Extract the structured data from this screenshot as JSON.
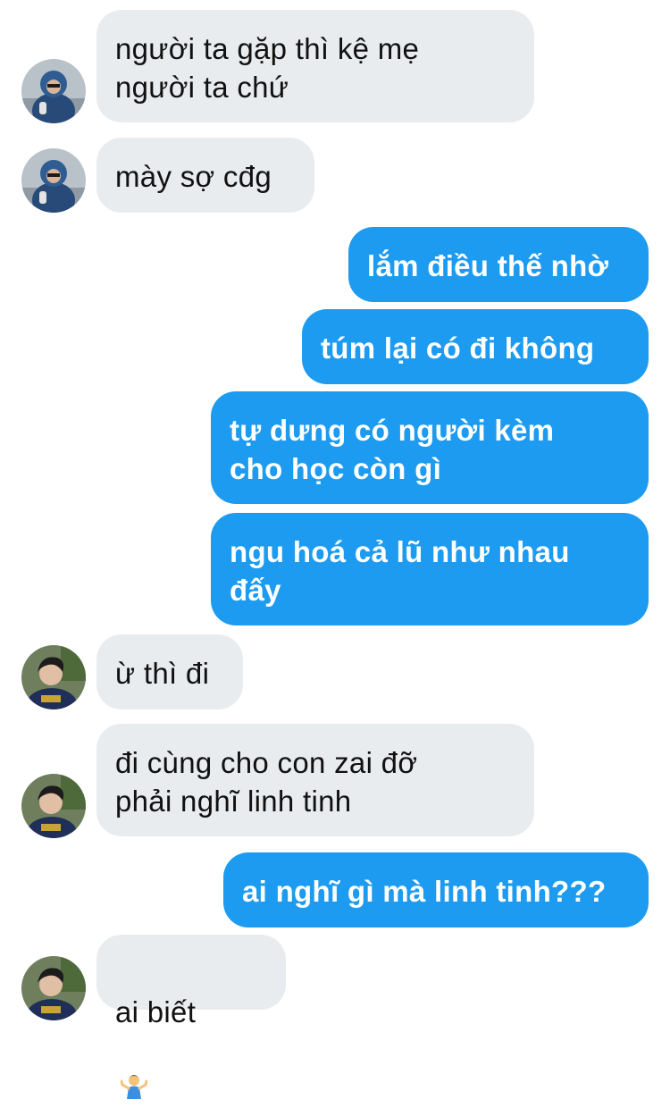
{
  "conversation": {
    "messages": [
      {
        "side": "in",
        "avatar": "person-a",
        "text": "người ta gặp thì kệ mẹ\nngười ta chứ"
      },
      {
        "side": "in",
        "avatar": "person-a",
        "text": "mày sợ cđg"
      },
      {
        "side": "out",
        "text": "lắm điều thế nhờ"
      },
      {
        "side": "out",
        "text": "túm lại có đi không"
      },
      {
        "side": "out",
        "text": "tự dưng có người kèm\ncho học còn gì"
      },
      {
        "side": "out",
        "text": "ngu hoá cả lũ như nhau\nđấy"
      },
      {
        "side": "in",
        "avatar": "person-b",
        "text": "ừ thì đi"
      },
      {
        "side": "in",
        "avatar": "person-b",
        "text": "đi cùng cho con zai đỡ\nphải nghĩ linh tinh"
      },
      {
        "side": "out",
        "text": "ai nghĩ gì mà linh tinh???"
      },
      {
        "side": "in",
        "avatar": "person-b",
        "text": "ai biết",
        "emoji": "person-shrugging-icon"
      }
    ]
  },
  "colors": {
    "incoming_bubble": "#e9ecef",
    "outgoing_bubble": "#1d9bf0",
    "incoming_text": "#111111",
    "outgoing_text": "#ffffff"
  }
}
